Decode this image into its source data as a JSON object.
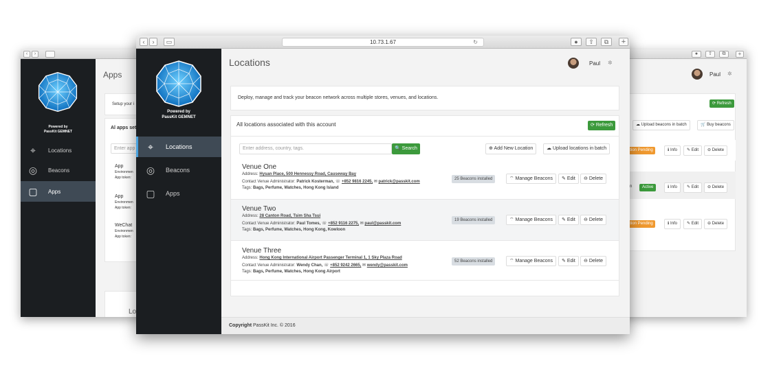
{
  "browser": {
    "url": "10.73.1.67"
  },
  "brand": {
    "powered_by": "Powered by",
    "name": "PassKit GEMNET"
  },
  "nav": {
    "items": [
      {
        "label": "Locations"
      },
      {
        "label": "Beacons"
      },
      {
        "label": "Apps"
      }
    ]
  },
  "user": {
    "name": "Paul"
  },
  "left": {
    "page_title": "Apps",
    "setup_text": "Setup your i",
    "section_title": "Al apps set",
    "search_placeholder": "Enter app",
    "apps": [
      {
        "name": "App",
        "env": "Environmen",
        "token": "App token:"
      },
      {
        "name": "App",
        "env": "Environmen",
        "token": "App token:"
      },
      {
        "name": "WeChat",
        "env": "Environmen",
        "token": "App token:"
      }
    ],
    "bottom": "Lo"
  },
  "right": {
    "refresh": "Refresh",
    "upload": "Upload beacons in batch",
    "buy": "Buy beacons",
    "rows": [
      {
        "status": "ation Pending",
        "info": "Info",
        "edit": "Edit",
        "delete": "Delete"
      },
      {
        "status": "Active",
        "pre": "n",
        "info": "Info",
        "edit": "Edit",
        "delete": "Delete"
      },
      {
        "status": "ation Pending",
        "info": "Info",
        "edit": "Edit",
        "delete": "Delete"
      }
    ]
  },
  "main": {
    "title": "Locations",
    "description": "Deploy, manage and track your beacon network across multiple stores, venues, and locations.",
    "panel_title": "All locations associated with this account",
    "refresh": "Refresh",
    "search_placeholder": "Enter address, country, tags.",
    "search_button": "Search",
    "add_button": "Add New Location",
    "upload_button": "Upload locations in batch",
    "copyright_bold": "Copyright",
    "copyright": "PassKit Inc. © 2016",
    "venues": [
      {
        "name": "Venue One",
        "addr_label": "Address:",
        "addr": "Hysan Place, 500 Hennessy Road, Causeway Bay",
        "contact_label": "Contact Venue Administrator:",
        "admin": "Patrick Kosterman,",
        "phone": "+852 9816 2245,",
        "email": "patrick@passkit.com",
        "tags_label": "Tags:",
        "tags": "Bags, Perfume, Watches, Hong Kong Island",
        "badge": "25 Beacons installed",
        "manage": "Manage Beacons",
        "edit": "Edit",
        "delete": "Delete"
      },
      {
        "name": "Venue Two",
        "addr_label": "Address:",
        "addr": "28 Canton Road, Tsim Sha Tsui",
        "contact_label": "Contact Venue Administrator:",
        "admin": "Paul Tomes,",
        "phone": "+852 9116 2275,",
        "email": "paul@passkit.com",
        "tags_label": "Tags:",
        "tags": "Bags, Perfume, Watches, Hong Kong, Kowloon",
        "badge": "19 Beacons installed",
        "manage": "Manage Beacons",
        "edit": "Edit",
        "delete": "Delete"
      },
      {
        "name": "Venue Three",
        "addr_label": "Address:",
        "addr": "Hong Kong International Airport Passenger Terminal 1, 1 Sky Plaza Road",
        "contact_label": "Contact Venue Administrator:",
        "admin": "Wendy Chan,",
        "phone": "+852 9242 2665,",
        "email": "wendy@passkit.com",
        "tags_label": "Tags:",
        "tags": "Bags, Perfume, Watches, Hong Kong Airport",
        "badge": "52 Beacons installed",
        "manage": "Manage Beacons",
        "edit": "Edit",
        "delete": "Delete"
      }
    ]
  }
}
